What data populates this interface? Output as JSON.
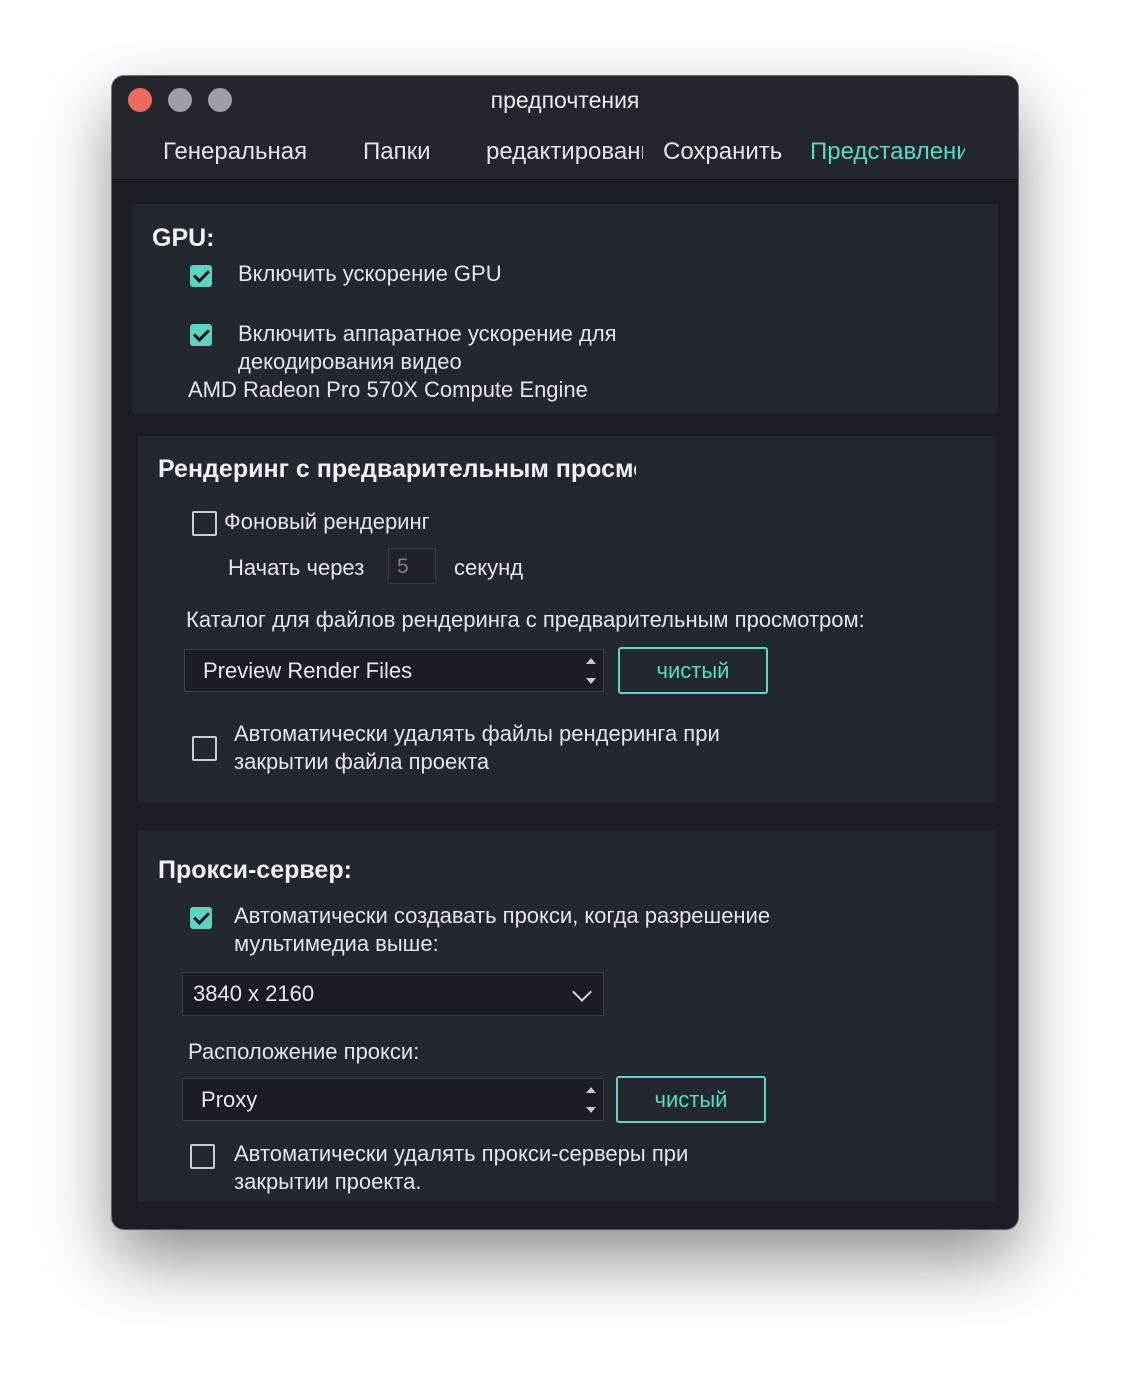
{
  "window": {
    "title": "предпочтения"
  },
  "tabs": [
    {
      "label": "Генеральная",
      "active": false
    },
    {
      "label": "Папки",
      "active": false
    },
    {
      "label": "редактирование",
      "active": false
    },
    {
      "label": "Сохранить",
      "active": false
    },
    {
      "label": "Представление",
      "active": true
    }
  ],
  "gpu": {
    "heading": "GPU:",
    "enable_gpu": {
      "label": "Включить ускорение GPU",
      "checked": true
    },
    "hw_decode": {
      "line1": "Включить аппаратное ускорение для",
      "line2": "декодирования видео",
      "checked": true
    },
    "device": "AMD Radeon Pro 570X Compute Engine"
  },
  "render": {
    "heading": "Рендеринг с предварительным просмотром:",
    "background_render": {
      "label": "Фоновый рендеринг",
      "checked": false
    },
    "start_after": {
      "prefix": "Начать через",
      "value": "5",
      "suffix": "секунд"
    },
    "catalog_label": "Каталог для файлов рендеринга с предварительным просмотром:",
    "catalog_select": "Preview Render Files",
    "clear_label": "чистый",
    "auto_delete": {
      "line1": "Автоматически удалять файлы рендеринга при",
      "line2": "закрытии файла проекта",
      "checked": false
    }
  },
  "proxy": {
    "heading": "Прокси-сервер:",
    "auto_create": {
      "line1": "Автоматически создавать прокси, когда разрешение",
      "line2": "мультимедиа выше:",
      "checked": true
    },
    "resolution_select": "3840 x 2160",
    "location_label": "Расположение прокси:",
    "location_select": "Proxy",
    "clear_label": "чистый",
    "auto_delete": {
      "line1": "Автоматически удалять прокси-серверы при",
      "line2": "закрытии проекта.",
      "checked": false
    }
  },
  "colors": {
    "accent": "#5dd7c6",
    "window_bg": "#1b1f25",
    "panel_bg": "#23272e",
    "close": "#ed6a5e"
  }
}
